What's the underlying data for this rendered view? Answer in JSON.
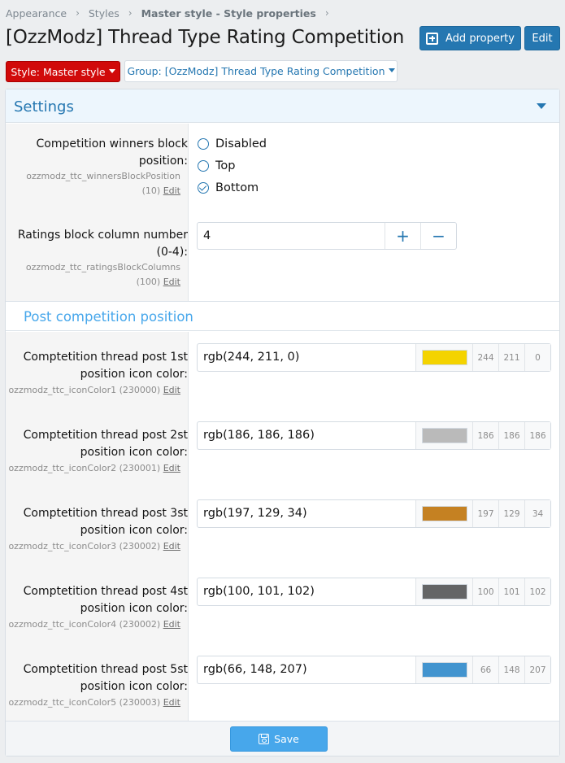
{
  "breadcrumb": [
    "Appearance",
    "Styles",
    "Master style - Style properties"
  ],
  "page_title": "[OzzModz] Thread Type Rating Competition",
  "buttons": {
    "add_property": "Add property",
    "edit": "Edit",
    "save": "Save"
  },
  "style_menu": "Style: Master style",
  "group_menu": "Group: [OzzModz] Thread Type Rating Competition",
  "block_title": "Settings",
  "winners_position": {
    "label": "Competition winners block position:",
    "property": "ozzmodz_ttc_winnersBlockPosition",
    "order": "(10)",
    "edit": "Edit",
    "options": [
      "Disabled",
      "Top",
      "Bottom"
    ],
    "selected": "Bottom"
  },
  "ratings_columns": {
    "label": "Ratings block column number (0-4):",
    "property": "ozzmodz_ttc_ratingsBlockColumns",
    "order": "(100)",
    "edit": "Edit",
    "value": "4",
    "plus": "+",
    "minus": "−"
  },
  "section_title": "Post competition position",
  "icon_colors": [
    {
      "label": "Comptetition thread post 1st position icon color:",
      "property": "ozzmodz_ttc_iconColor1 (230000)",
      "edit": "Edit",
      "value": "rgb(244, 211, 0)",
      "hex": "#f4d300",
      "r": "244",
      "g": "211",
      "b": "0"
    },
    {
      "label": "Comptetition thread post 2st position icon color:",
      "property": "ozzmodz_ttc_iconColor2 (230001)",
      "edit": "Edit",
      "value": "rgb(186, 186, 186)",
      "hex": "#bababa",
      "r": "186",
      "g": "186",
      "b": "186"
    },
    {
      "label": "Comptetition thread post 3st position icon color:",
      "property": "ozzmodz_ttc_iconColor3 (230002)",
      "edit": "Edit",
      "value": "rgb(197, 129, 34)",
      "hex": "#c58122",
      "r": "197",
      "g": "129",
      "b": "34"
    },
    {
      "label": "Comptetition thread post 4st position icon color:",
      "property": "ozzmodz_ttc_iconColor4 (230002)",
      "edit": "Edit",
      "value": "rgb(100, 101, 102)",
      "hex": "#646566",
      "r": "100",
      "g": "101",
      "b": "102"
    },
    {
      "label": "Comptetition thread post 5st position icon color:",
      "property": "ozzmodz_ttc_iconColor5 (230003)",
      "edit": "Edit",
      "value": "rgb(66, 148, 207)",
      "hex": "#4294cf",
      "r": "66",
      "g": "148",
      "b": "207"
    }
  ]
}
